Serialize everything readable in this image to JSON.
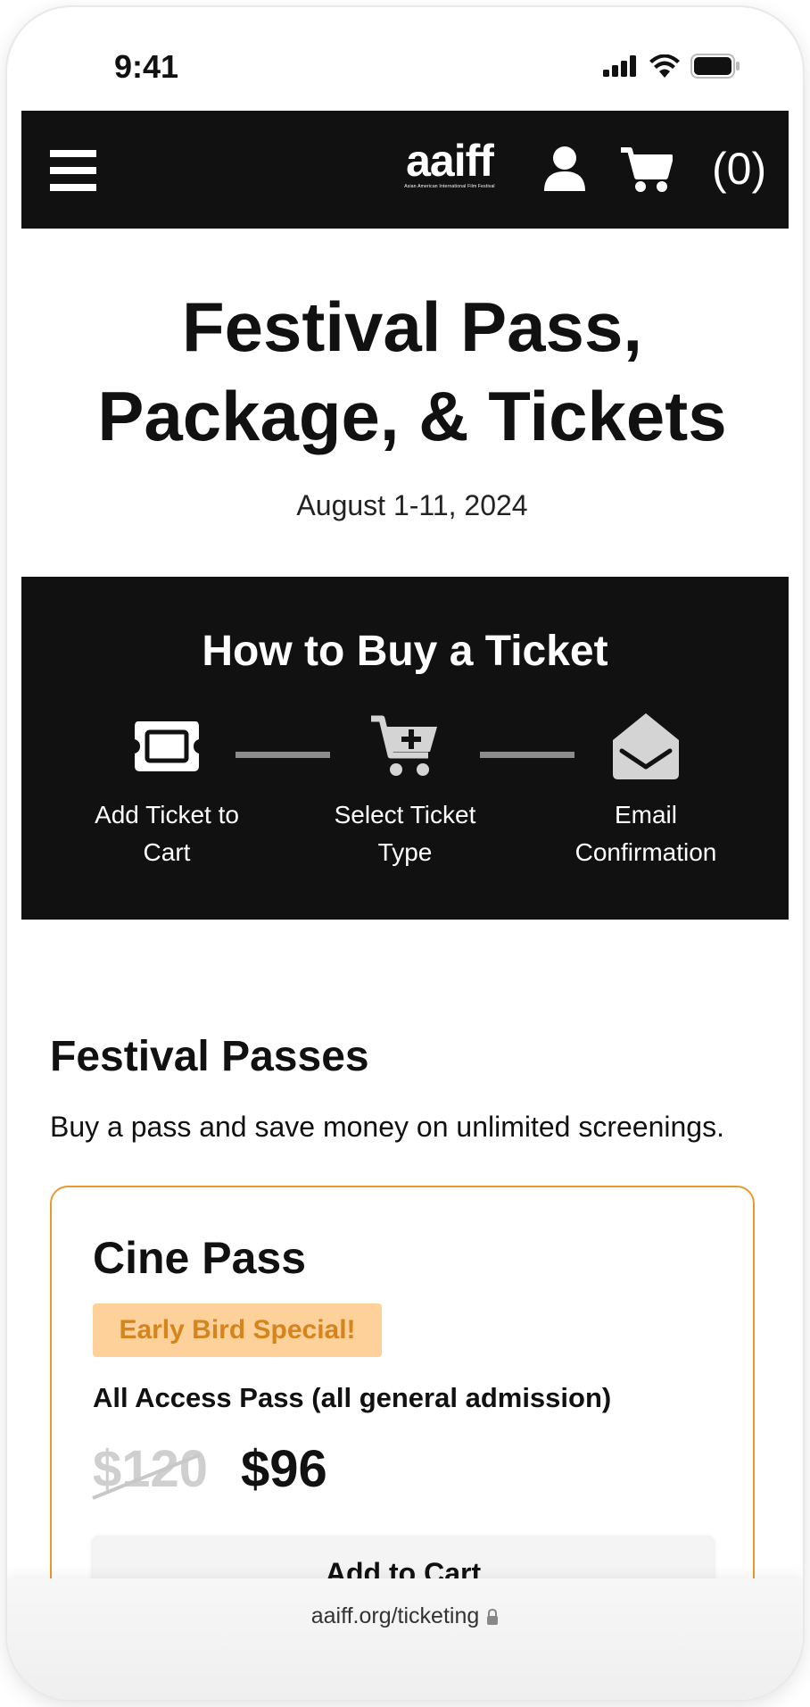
{
  "status": {
    "time": "9:41",
    "icons": [
      "signal-icon",
      "wifi-icon",
      "battery-icon"
    ]
  },
  "nav": {
    "menu_icon": "hamburger-menu-icon",
    "logo_text": "aaiff",
    "logo_subtitle": "Asian American International Film Festival",
    "account_icon": "user-icon",
    "cart_icon": "cart-icon",
    "cart_count": "(0)"
  },
  "hero": {
    "title_line1": "Festival Pass,",
    "title_line2": "Package, & Tickets",
    "date": "August 1-11, 2024"
  },
  "how_to": {
    "title": "How to Buy a Ticket",
    "steps": [
      {
        "icon": "ticket-icon",
        "line1": "Add Ticket to",
        "line2": "Cart"
      },
      {
        "icon": "cart-plus-icon",
        "line1": "Select Ticket",
        "line2": "Type"
      },
      {
        "icon": "envelope-open-icon",
        "line1": "Email",
        "line2": "Confirmation"
      }
    ]
  },
  "passes": {
    "title": "Festival Passes",
    "description": "Buy a pass and save money on unlimited screenings.",
    "items": [
      {
        "name": "Cine Pass",
        "badge": "Early Bird Special!",
        "description": "All Access Pass (all general admission)",
        "price_original": "$120",
        "price_sale": "$96",
        "button_label": "Add to Cart"
      }
    ]
  },
  "browser": {
    "url": "aaiff.org/ticketing",
    "lock_icon": "lock-icon"
  },
  "colors": {
    "nav_bg": "#111111",
    "accent_border": "#e89a2c",
    "badge_bg": "#fdd199",
    "badge_text": "#d6841c",
    "step_icon_gray": "#d4d4d4"
  }
}
